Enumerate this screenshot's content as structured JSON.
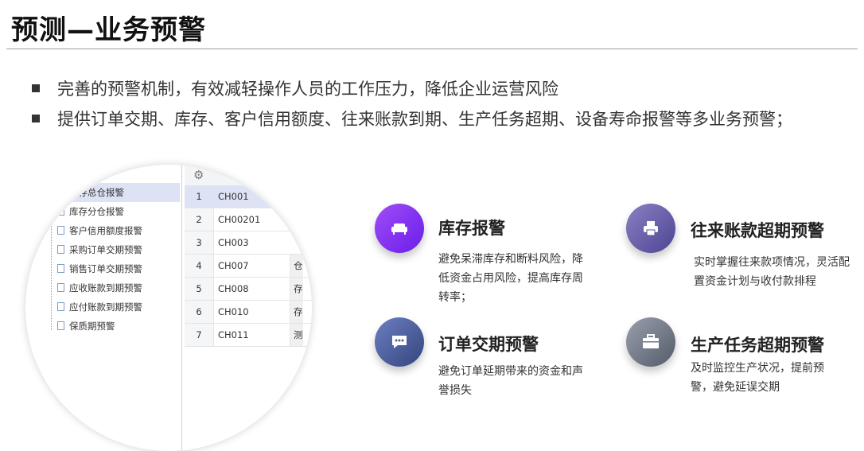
{
  "page": {
    "title": "预测—业务预警"
  },
  "bullets": [
    "完善的预警机制，有效减轻操作人员的工作压力，降低企业运营风险",
    "提供订单交期、库存、客户信用额度、往来账款到期、生产任务超期、设备寿命报警等多业务预警；"
  ],
  "screenshot": {
    "tree_items": [
      "库存总仓报警",
      "库存分仓报警",
      "客户信用额度报警",
      "采购订单交期预警",
      "销售订单交期预警",
      "应收账款到期预警",
      "应付账款到期预警",
      "保质期预警"
    ],
    "rows": [
      {
        "num": "1",
        "code": "CH001",
        "extra": ""
      },
      {
        "num": "2",
        "code": "CH00201",
        "extra": ""
      },
      {
        "num": "3",
        "code": "CH003",
        "extra": ""
      },
      {
        "num": "4",
        "code": "CH007",
        "extra": "仓"
      },
      {
        "num": "5",
        "code": "CH008",
        "extra": "存"
      },
      {
        "num": "6",
        "code": "CH010",
        "extra": "存"
      },
      {
        "num": "7",
        "code": "CH011",
        "extra": "测"
      }
    ]
  },
  "features": [
    {
      "title": "库存报警",
      "desc": "避免呆滞库存和断料风险，降低资金占用风险，提高库存周转率；",
      "icon": "sofa-icon",
      "color": "#7b2ff7"
    },
    {
      "title": "往来账款超期预警",
      "desc": "实时掌握往来款项情况，灵活配置资金计划与收付款排程",
      "icon": "printer-icon",
      "color": "#6a63a8"
    },
    {
      "title": "订单交期预警",
      "desc": "避免订单延期带来的资金和声誉损失",
      "icon": "chat-icon",
      "color": "#4a5d9e"
    },
    {
      "title": "生产任务超期预警",
      "desc": "及时监控生产状况，提前预警，避免延误交期",
      "icon": "briefcase-icon",
      "color": "#6e7584"
    }
  ]
}
